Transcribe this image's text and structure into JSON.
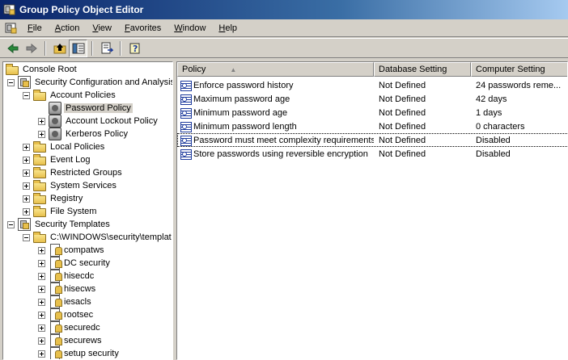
{
  "window": {
    "title": "Group Policy Object Editor"
  },
  "menu": [
    "File",
    "Action",
    "View",
    "Favorites",
    "Window",
    "Help"
  ],
  "toolbar": {
    "buttons": [
      "back-icon",
      "forward-icon",
      "up-one-level-icon",
      "show-hide-tree-icon",
      "export-list-icon",
      "help-icon"
    ]
  },
  "tree": [
    {
      "label": "Console Root",
      "level": 0,
      "icon": "folder-icon",
      "expander": "none"
    },
    {
      "label": "Security Configuration and Analysis",
      "level": 1,
      "icon": "security-config-icon",
      "expander": "minus"
    },
    {
      "label": "Account Policies",
      "level": 2,
      "icon": "folder-icon",
      "expander": "minus"
    },
    {
      "label": "Password Policy",
      "level": 3,
      "icon": "policy-icon",
      "expander": "none",
      "selected": true
    },
    {
      "label": "Account Lockout Policy",
      "level": 3,
      "icon": "policy-icon",
      "expander": "plus"
    },
    {
      "label": "Kerberos Policy",
      "level": 3,
      "icon": "policy-icon",
      "expander": "plus"
    },
    {
      "label": "Local Policies",
      "level": 2,
      "icon": "folder-icon",
      "expander": "plus"
    },
    {
      "label": "Event Log",
      "level": 2,
      "icon": "folder-icon",
      "expander": "plus"
    },
    {
      "label": "Restricted Groups",
      "level": 2,
      "icon": "folder-icon",
      "expander": "plus"
    },
    {
      "label": "System Services",
      "level": 2,
      "icon": "folder-icon",
      "expander": "plus"
    },
    {
      "label": "Registry",
      "level": 2,
      "icon": "folder-icon",
      "expander": "plus"
    },
    {
      "label": "File System",
      "level": 2,
      "icon": "folder-icon",
      "expander": "plus"
    },
    {
      "label": "Security Templates",
      "level": 1,
      "icon": "security-config-icon",
      "expander": "minus"
    },
    {
      "label": "C:\\WINDOWS\\security\\templat",
      "level": 2,
      "icon": "folder-icon",
      "expander": "minus"
    },
    {
      "label": "compatws",
      "level": 3,
      "icon": "template-icon",
      "expander": "plus"
    },
    {
      "label": "DC security",
      "level": 3,
      "icon": "template-icon",
      "expander": "plus"
    },
    {
      "label": "hisecdc",
      "level": 3,
      "icon": "template-icon",
      "expander": "plus"
    },
    {
      "label": "hisecws",
      "level": 3,
      "icon": "template-icon",
      "expander": "plus"
    },
    {
      "label": "iesacls",
      "level": 3,
      "icon": "template-icon",
      "expander": "plus"
    },
    {
      "label": "rootsec",
      "level": 3,
      "icon": "template-icon",
      "expander": "plus"
    },
    {
      "label": "securedc",
      "level": 3,
      "icon": "template-icon",
      "expander": "plus"
    },
    {
      "label": "securews",
      "level": 3,
      "icon": "template-icon",
      "expander": "plus"
    },
    {
      "label": "setup security",
      "level": 3,
      "icon": "template-icon",
      "expander": "plus"
    }
  ],
  "list": {
    "columns": [
      "Policy",
      "Database Setting",
      "Computer Setting"
    ],
    "rows": [
      {
        "policy": "Enforce password history",
        "db": "Not Defined",
        "comp": "24 passwords reme..."
      },
      {
        "policy": "Maximum password age",
        "db": "Not Defined",
        "comp": "42 days"
      },
      {
        "policy": "Minimum password age",
        "db": "Not Defined",
        "comp": "1 days"
      },
      {
        "policy": "Minimum password length",
        "db": "Not Defined",
        "comp": "0 characters"
      },
      {
        "policy": "Password must meet complexity requirements",
        "db": "Not Defined",
        "comp": "Disabled",
        "focused": true
      },
      {
        "policy": "Store passwords using reversible encryption",
        "db": "Not Defined",
        "comp": "Disabled"
      }
    ]
  }
}
